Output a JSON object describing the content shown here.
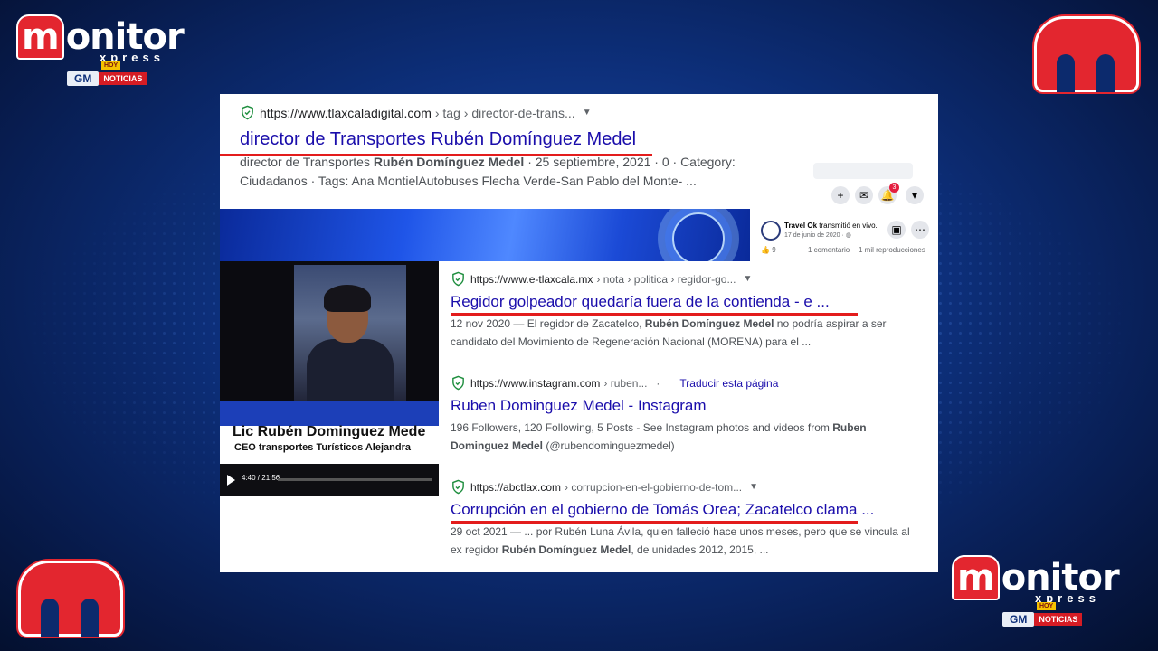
{
  "brand": {
    "word_tail": "onitor",
    "word_m": "m",
    "sub": "xpress",
    "gm_a": "GM",
    "gm_b": "NOTICIAS",
    "hoy": "HOY"
  },
  "results": [
    {
      "host": "https://www.tlaxcaladigital.com",
      "path": "› tag › director-de-trans...",
      "title": "director de Transportes Rubén Domínguez Medel",
      "snippet_a": "director de Transportes ",
      "snippet_b": "Rubén Domínguez Medel",
      "snippet_c": " · 25 septiembre, 2021 · 0 · Category:",
      "snippet_d": "Ciudadanos · Tags: Ana MontielAutobuses Flecha Verde-San Pablo del Monte- ..."
    },
    {
      "host": "https://www.e-tlaxcala.mx",
      "path": "› nota › politica › regidor-go...",
      "title": "Regidor golpeador quedaría fuera de la contienda - e ...",
      "snippet_a": "12 nov 2020 — El regidor de Zacatelco, ",
      "snippet_b": "Rubén Domínguez Medel",
      "snippet_c": " no podría aspirar a ser",
      "snippet_d": "candidato del Movimiento de Regeneración Nacional (MORENA) para el ..."
    },
    {
      "host": "https://www.instagram.com",
      "path": "› ruben...",
      "translate": "Traducir esta página",
      "title": "Ruben Dominguez Medel - Instagram",
      "snippet_a": "196 Followers, 120 Following, 5 Posts - See Instagram photos and videos from ",
      "snippet_b": "Ruben",
      "snippet_c": "Dominguez Medel",
      "snippet_d": " (@rubendominguezmedel)"
    },
    {
      "host": "https://abctlax.com",
      "path": "› corrupcion-en-el-gobierno-de-tom...",
      "title": "Corrupción en el gobierno de Tomás Orea; Zacatelco clama ...",
      "snippet_a": "29 oct 2021 — ... por Rubén Luna Ávila, quien falleció hace unos meses, pero que se vincula al",
      "snippet_b": "ex regidor ",
      "snippet_c": "Rubén Domínguez Medel",
      "snippet_d": ", de unidades 2012, 2015, ..."
    }
  ],
  "video": {
    "name": "Lic Rubén Dominguez Mede",
    "role": "CEO transportes Turísticos Alejandra",
    "time": "4:40 / 21:56"
  },
  "fb": {
    "page": "Travel Ok",
    "live": "transmitió en vivo.",
    "date": "17 de junio de 2020 · ",
    "reactions": "9",
    "comments": "1 comentario",
    "views": "1 mil reproducciones",
    "badge": "3"
  }
}
